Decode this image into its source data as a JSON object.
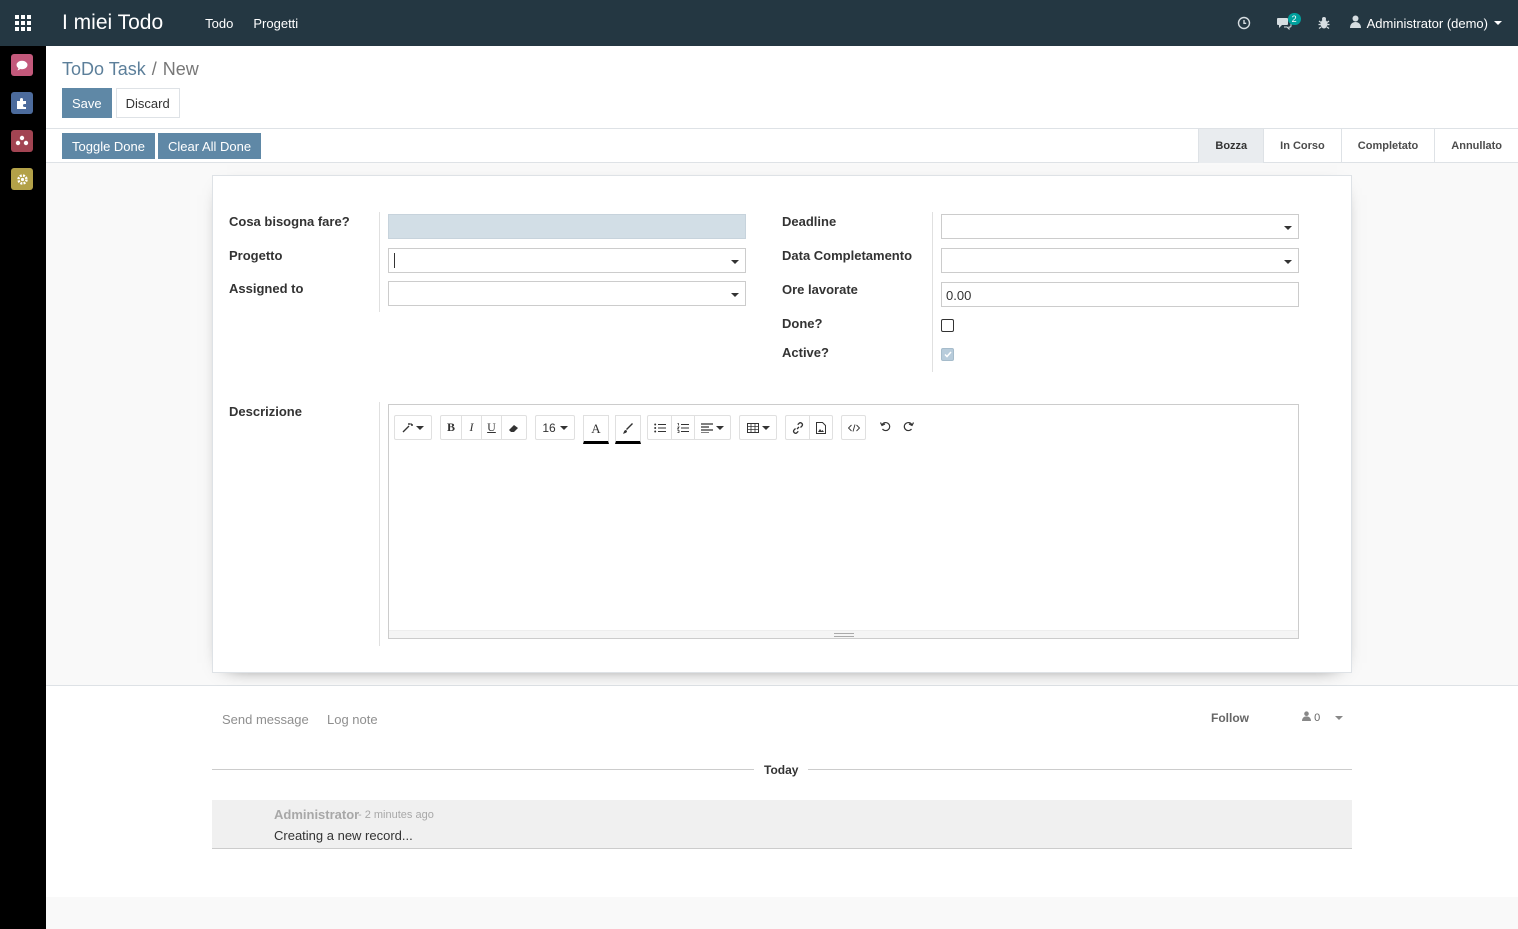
{
  "navbar": {
    "brand": "I miei Todo",
    "menu": [
      "Todo",
      "Progetti"
    ],
    "messages_badge": "2",
    "user": "Administrator (demo)"
  },
  "sidebar": {
    "apps": [
      {
        "name": "discuss",
        "color": "#c3597b"
      },
      {
        "name": "apps",
        "color": "#4c6b9c"
      },
      {
        "name": "contacts",
        "color": "#a24452"
      },
      {
        "name": "settings",
        "color": "#b3a148"
      }
    ]
  },
  "breadcrumb": {
    "parent": "ToDo Task",
    "separator": "/",
    "current": "New"
  },
  "control_panel": {
    "save_label": "Save",
    "discard_label": "Discard"
  },
  "header": {
    "toggle_done": "Toggle Done",
    "clear_all_done": "Clear All Done",
    "stages": [
      "Bozza",
      "In Corso",
      "Completato",
      "Annullato"
    ],
    "active_stage": "Bozza"
  },
  "form": {
    "left": {
      "name_label": "Cosa bisogna fare?",
      "project_label": "Progetto",
      "assigned_label": "Assigned to"
    },
    "right": {
      "deadline_label": "Deadline",
      "completion_label": "Data Completamento",
      "hours_label": "Ore lavorate",
      "hours_value": "0.00",
      "done_label": "Done?",
      "done_checked": false,
      "active_label": "Active?",
      "active_checked": true
    },
    "description_label": "Descrizione",
    "editor": {
      "font_size": "16"
    }
  },
  "chatter": {
    "send_message": "Send message",
    "log_note": "Log note",
    "follow": "Follow",
    "followers_count": "0",
    "day": "Today",
    "messages": [
      {
        "author": "Administrator",
        "date": "- 2 minutes ago",
        "body": "Creating a new record..."
      }
    ]
  },
  "colors": {
    "navbar": "#243742",
    "primary": "#5f88a6"
  }
}
